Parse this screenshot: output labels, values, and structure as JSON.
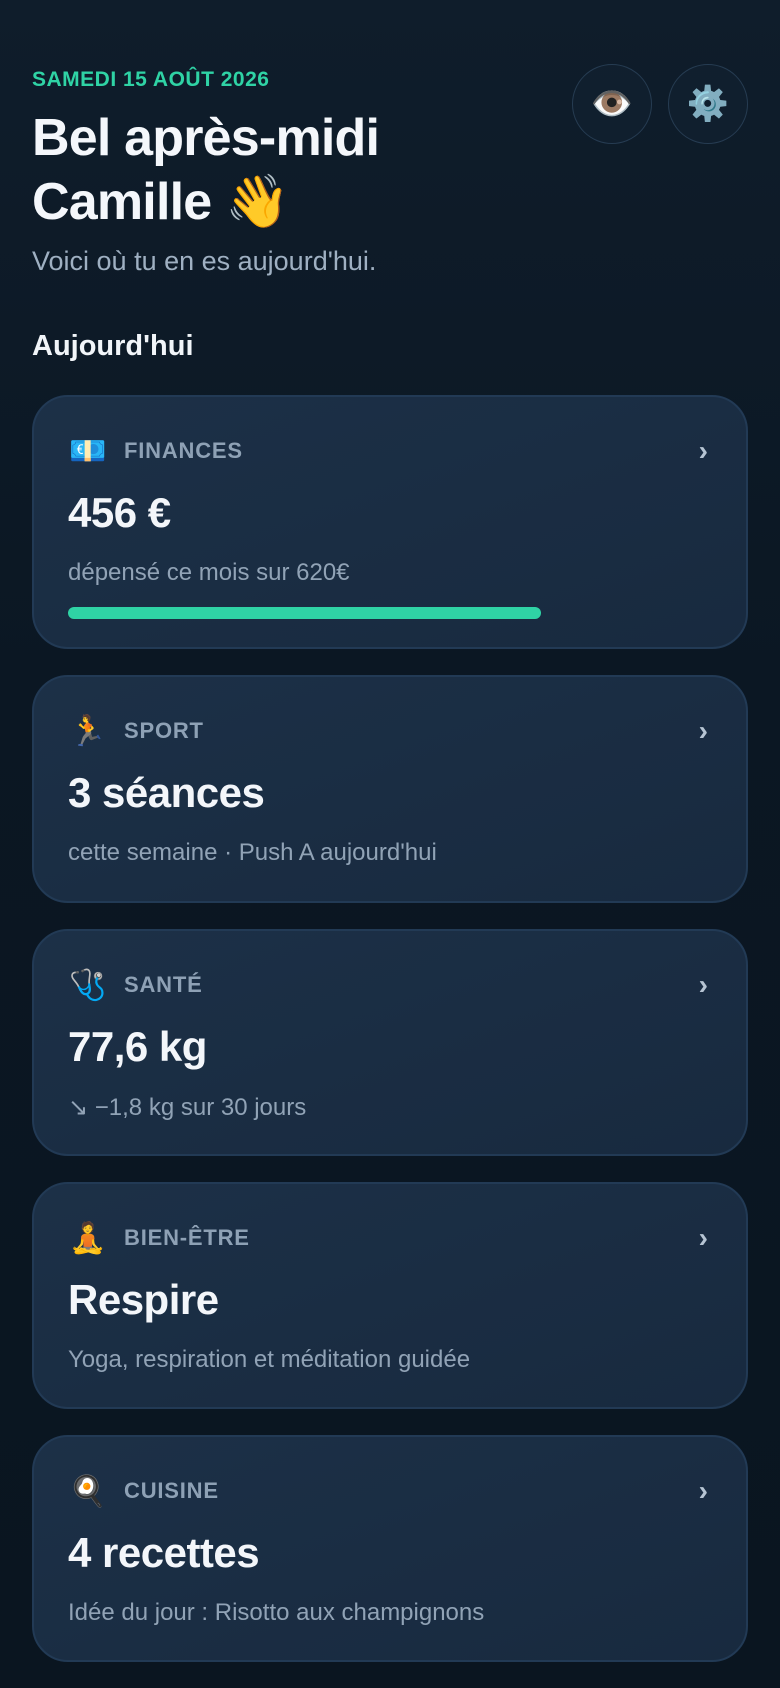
{
  "header": {
    "date": "SAMEDI 15 AOÛT 2026",
    "greeting_line1": "Bel après-midi",
    "greeting_line2": "Camille 👋",
    "subtitle": "Voici où tu en es aujourd'hui.",
    "buttons": {
      "eye_icon": "👁️",
      "gear_icon": "⚙️"
    }
  },
  "section": {
    "title": "Aujourd'hui"
  },
  "cards": [
    {
      "icon": "💶",
      "icon_name": "euro-banknote-icon",
      "category": "FINANCES",
      "value": "456 €",
      "description": "dépensé ce mois sur 620€",
      "progress": 0.735
    },
    {
      "icon": "🏃",
      "icon_name": "running-person-icon",
      "category": "SPORT",
      "value": "3 séances",
      "description": "cette semaine · Push A aujourd'hui"
    },
    {
      "icon": "🩺",
      "icon_name": "stethoscope-icon",
      "category": "SANTÉ",
      "value": "77,6 kg",
      "description": "↘ −1,8 kg sur 30 jours"
    },
    {
      "icon": "🧘",
      "icon_name": "meditation-icon",
      "category": "BIEN-ÊTRE",
      "value": "Respire",
      "description": "Yoga, respiration et méditation guidée"
    },
    {
      "icon": "🍳",
      "icon_name": "cooking-pan-icon",
      "category": "CUISINE",
      "value": "4 recettes",
      "description": "Idée du jour : Risotto aux champignons"
    }
  ],
  "chevron": "›",
  "colors": {
    "accent": "#2fd3a5",
    "background": "#0b1723",
    "card": "#1a2d43"
  }
}
